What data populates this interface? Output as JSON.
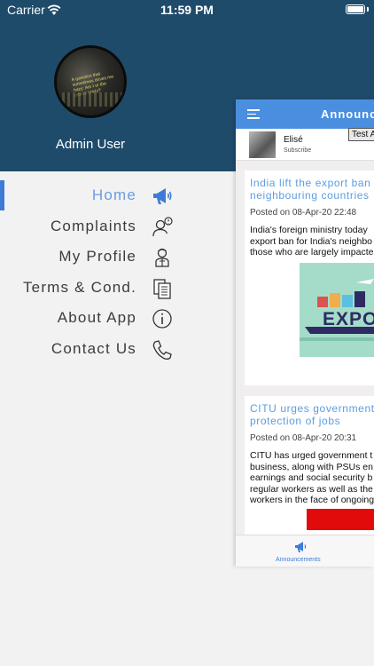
{
  "status_bar": {
    "carrier": "Carrier",
    "time": "11:59 PM"
  },
  "drawer": {
    "user_name": "Admin User",
    "avatar_text": "A question that sometimes drives me hazy: Am I or the others crazy?",
    "menu": [
      {
        "label": "Home",
        "icon": "megaphone-icon",
        "active": true
      },
      {
        "label": "Complaints",
        "icon": "complaint-user-icon",
        "active": false
      },
      {
        "label": "My Profile",
        "icon": "profile-icon",
        "active": false
      },
      {
        "label": "Terms & Cond.",
        "icon": "documents-icon",
        "active": false
      },
      {
        "label": "About App",
        "icon": "info-icon",
        "active": false
      },
      {
        "label": "Contact Us",
        "icon": "phone-icon",
        "active": false
      }
    ]
  },
  "main": {
    "title": "Announcements",
    "profile": {
      "name": "Elisé",
      "subtitle": "Subscribe"
    },
    "tooltip": "Test Ac",
    "cards": [
      {
        "title": "India lift the export ban for neighbouring countries",
        "date": "Posted on 08-Apr-20 22:48",
        "body": "India's foreign ministry today export ban for India's neighbo those who are largely impacte",
        "image_text": "EXPO"
      },
      {
        "title": "CITU urges government protection of jobs",
        "date": "Posted on 08-Apr-20 20:31",
        "body": "CITU has urged government t business, along with PSUs en earnings and social security b regular workers as well as the workers in the face of ongoing"
      }
    ],
    "tabbar": {
      "label": "Announcements"
    }
  },
  "colors": {
    "header_bg": "#1f4b6b",
    "accent": "#4a8ee0",
    "active_text": "#6a9edc",
    "link_title": "#5b9de0"
  }
}
